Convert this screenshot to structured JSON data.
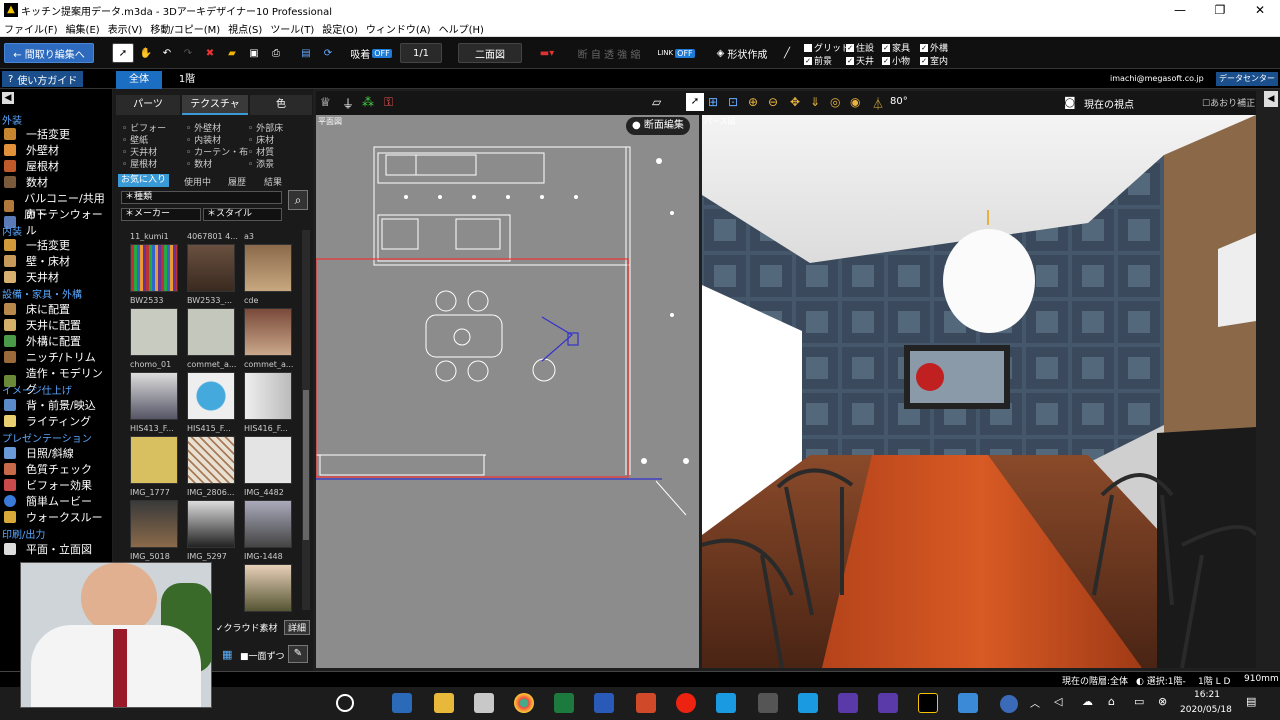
{
  "window": {
    "title": "キッチン提案用データ.m3da - 3Dアーキデザイナー10 Professional",
    "min": "—",
    "max": "❐",
    "close": "✕"
  },
  "menu": [
    "ファイル(F)",
    "編集(E)",
    "表示(V)",
    "移動/コピー(M)",
    "視点(S)",
    "ツール(T)",
    "設定(O)",
    "ウィンドウ(A)",
    "ヘルプ(H)"
  ],
  "toolbar": {
    "back": "← 間取り編集へ",
    "snap": "吸着",
    "off": "OFF",
    "page": "1/1",
    "twoview": "二面図",
    "disabled_group": "断 自 透 強 縮",
    "link": "LINK",
    "shape": "形状作成",
    "checks": [
      {
        "label": "グリッド",
        "checked": false
      },
      {
        "label": "前景",
        "checked": true
      },
      {
        "label": "住設",
        "checked": true
      },
      {
        "label": "天井",
        "checked": true
      },
      {
        "label": "家具",
        "checked": true
      },
      {
        "label": "小物",
        "checked": true
      },
      {
        "label": "外構",
        "checked": true
      },
      {
        "label": "室内",
        "checked": true
      }
    ]
  },
  "subbar": {
    "guide": "使い方ガイド",
    "tab_all": "全体",
    "tab_floor": "1階",
    "email": "imachi@megasoft.co.jp",
    "datacenter": "データセンター"
  },
  "nav": {
    "sections": [
      "外装",
      "内装",
      "設備・家具・外構",
      "イメージ仕上げ",
      "プレゼンテーション",
      "印刷/出力"
    ],
    "exterior": [
      "一括変更",
      "外壁材",
      "屋根材",
      "数材",
      "バルコニー/共用廊下",
      "カーテンウォール"
    ],
    "interior": [
      "一括変更",
      "壁・床材",
      "天井材"
    ],
    "equipment": [
      "床に配置",
      "天井に配置",
      "外構に配置",
      "ニッチ/トリム",
      "造作・モデリング"
    ],
    "image": [
      "背・前景/映込",
      "ライティング"
    ],
    "presentation": [
      "日照/斜線",
      "色質チェック",
      "ビフォー効果",
      "簡単ムービー",
      "ウォークスルー"
    ],
    "print": [
      "平面・立面図"
    ]
  },
  "panel": {
    "tabs": [
      "パーツ",
      "テクスチャ",
      "色"
    ],
    "categories": [
      [
        "ビフォー",
        "外壁材",
        "外部床"
      ],
      [
        "壁紙",
        "内装材",
        "床材"
      ],
      [
        "天井材",
        "カーテン・布",
        "材質"
      ],
      [
        "屋根材",
        "数材",
        "添景"
      ]
    ],
    "filters": [
      "お気に入り",
      "使用中",
      "履歴",
      "結果"
    ],
    "kind": "＊種類",
    "maker": "＊メーカー",
    "style": "＊スタイル",
    "thumb_labels": [
      "11_kumi1",
      "4067801 4...",
      "a3",
      "BW2533",
      "BW2533_...",
      "cde",
      "chomo_01",
      "commet_a...",
      "commet_a...",
      "HIS413_F...",
      "HIS415_F...",
      "HIS416_F...",
      "IMG_1777",
      "IMG_2806...",
      "IMG_4482",
      "IMG_5018",
      "IMG_5297",
      "IMG-1448"
    ],
    "cloud": "クラウド素材",
    "detail": "詳細",
    "onebyone": "一面ずつ"
  },
  "views": {
    "plan_label": "平面図",
    "section_button": "断面編集",
    "persp_label": "パース図",
    "fov": "80°",
    "viewpoint": "現在の視点",
    "correction": "あおり補正"
  },
  "status": {
    "floor": "現在の階層:全体",
    "select": "選択:1階-",
    "ldk": "1階 L D",
    "dim": "910mm"
  },
  "taskbar": {
    "time": "16:21",
    "date": "2020/05/18"
  }
}
